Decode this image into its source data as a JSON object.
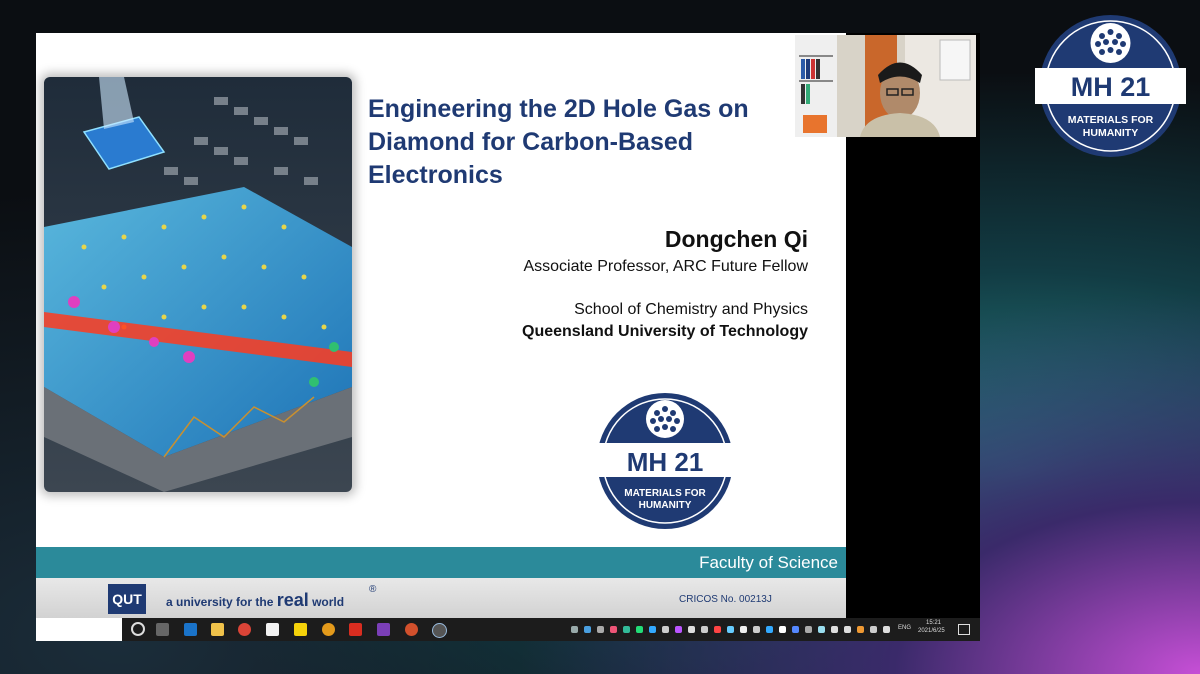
{
  "slide": {
    "title": "Engineering the 2D Hole Gas on Diamond for Carbon-Based Electronics",
    "presenter_name": "Dongchen Qi",
    "presenter_role": "Associate Professor, ARC Future Fellow",
    "school": "School of Chemistry and Physics",
    "university": "Queensland University of Technology",
    "faculty": "Faculty of Science",
    "qut_logo": "QUT",
    "tagline_small": "a university for the",
    "tagline_big": "real",
    "tagline_end": "world",
    "copyright_mark": "®",
    "cricos": "CRICOS No. 00213J"
  },
  "logo": {
    "name": "MH 21",
    "subtitle_1": "MATERIALS FOR",
    "subtitle_2": "HUMANITY"
  },
  "taskbar": {
    "language": "ENG",
    "time": "15:21",
    "date": "2021/6/25",
    "apps": [
      "cortana-icon",
      "task-view-icon",
      "outlook-icon",
      "file-explorer-icon",
      "chrome-icon",
      "file-icon",
      "sticky-notes-icon",
      "search-icon",
      "acrobat-icon",
      "onenote-icon",
      "powerpoint-icon",
      "zoom-icon"
    ]
  },
  "colors": {
    "accent_navy": "#1f3a73",
    "teal": "#2b8a9a"
  }
}
